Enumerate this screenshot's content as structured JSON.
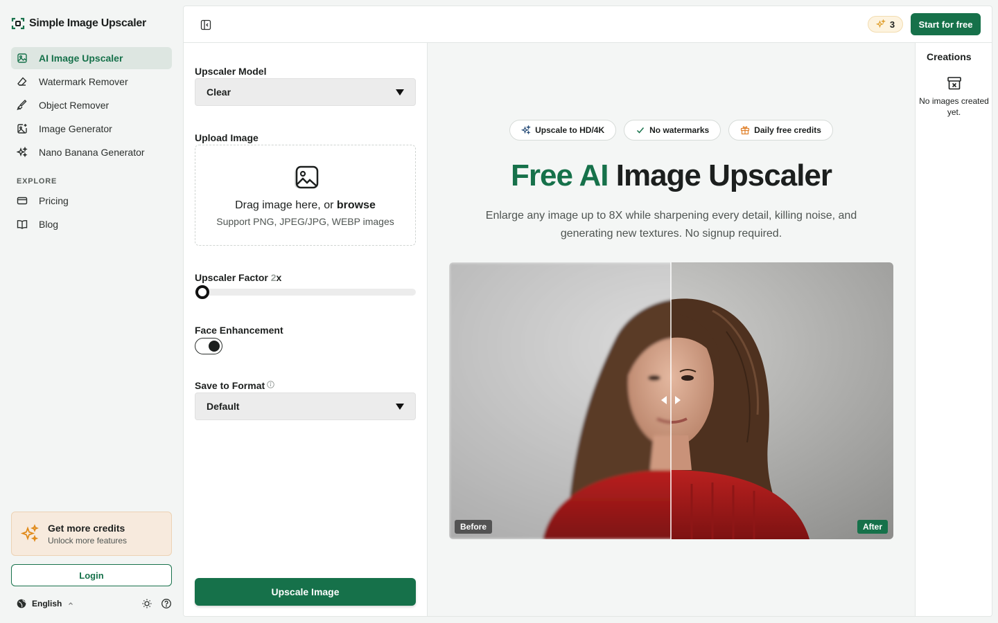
{
  "brand": {
    "name": "Simple Image Upscaler"
  },
  "sidebar": {
    "items": [
      {
        "label": "AI Image Upscaler",
        "icon": "image-sparkle-icon",
        "active": true
      },
      {
        "label": "Watermark Remover",
        "icon": "eraser-icon"
      },
      {
        "label": "Object Remover",
        "icon": "brush-icon"
      },
      {
        "label": "Image Generator",
        "icon": "image-plus-icon"
      },
      {
        "label": "Nano Banana Generator",
        "icon": "sparkles-icon"
      }
    ],
    "explore_heading": "EXPLORE",
    "explore_items": [
      {
        "label": "Pricing",
        "icon": "credit-card-icon"
      },
      {
        "label": "Blog",
        "icon": "book-icon"
      }
    ],
    "credits_card": {
      "title": "Get more credits",
      "subtitle": "Unlock more features"
    },
    "login_label": "Login",
    "language": "English"
  },
  "topbar": {
    "credits": "3",
    "start_label": "Start for free"
  },
  "controls": {
    "model_label": "Upscaler Model",
    "model_value": "Clear",
    "upload_label": "Upload Image",
    "dropzone_text": "Drag image here, or ",
    "dropzone_link": "browse",
    "dropzone_sub": "Support PNG, JPEG/JPG, WEBP images",
    "factor_label": "Upscaler Factor ",
    "factor_value": "2",
    "factor_suffix": "x",
    "face_label": "Face Enhancement",
    "face_enabled": true,
    "format_label": "Save to Format",
    "format_value": "Default",
    "upscale_label": "Upscale Image"
  },
  "hero": {
    "badges": [
      {
        "label": "Upscale to HD/4K",
        "icon": "sparkles-icon"
      },
      {
        "label": "No watermarks",
        "icon": "check-icon"
      },
      {
        "label": "Daily free credits",
        "icon": "gift-icon"
      }
    ],
    "title_green": "Free AI",
    "title_rest": " Image Upscaler",
    "subtitle": "Enlarge any image up to 8X while sharpening every detail, killing noise, and generating new textures. No signup required.",
    "before_label": "Before",
    "after_label": "After"
  },
  "creations": {
    "title": "Creations",
    "empty_text": "No images created yet."
  },
  "colors": {
    "accent": "#16714a",
    "background": "#f3f5f4",
    "credits_bg": "#f7eadd"
  }
}
